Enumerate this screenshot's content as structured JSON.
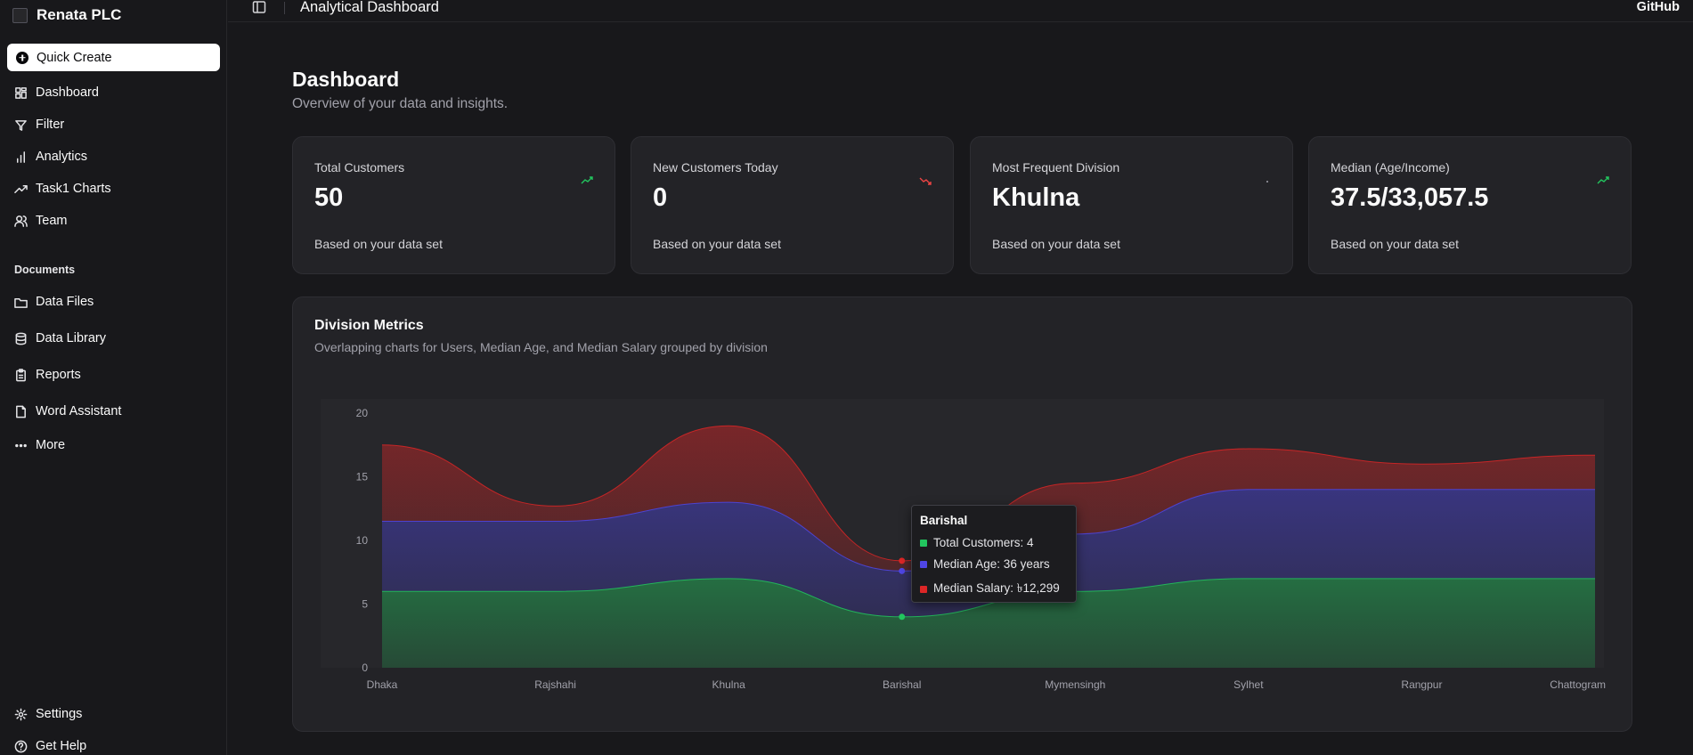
{
  "app": {
    "name": "Renata PLC"
  },
  "sidebar": {
    "quick_create": "Quick Create",
    "items": [
      {
        "label": "Dashboard",
        "icon": "dashboard-icon"
      },
      {
        "label": "Filter",
        "icon": "filter-icon"
      },
      {
        "label": "Analytics",
        "icon": "bar-chart-icon"
      },
      {
        "label": "Task1 Charts",
        "icon": "trending-icon"
      },
      {
        "label": "Team",
        "icon": "users-icon"
      }
    ],
    "documents_label": "Documents",
    "documents": [
      {
        "label": "Data Files",
        "icon": "folder-icon"
      },
      {
        "label": "Data Library",
        "icon": "database-icon"
      },
      {
        "label": "Reports",
        "icon": "clipboard-icon"
      },
      {
        "label": "Word Assistant",
        "icon": "file-icon"
      },
      {
        "label": "More",
        "icon": "more-icon"
      }
    ],
    "footer": [
      {
        "label": "Settings",
        "icon": "gear-icon"
      },
      {
        "label": "Get Help",
        "icon": "help-icon"
      }
    ]
  },
  "topbar": {
    "title": "Analytical Dashboard",
    "github": "GitHub"
  },
  "page": {
    "title": "Dashboard",
    "subtitle": "Overview of your data and insights."
  },
  "cards": [
    {
      "label": "Total Customers",
      "value": "50",
      "foot": "Based on your data set",
      "trend": "up",
      "trend_color": "#22c55e"
    },
    {
      "label": "New Customers Today",
      "value": "0",
      "foot": "Based on your data set",
      "trend": "down",
      "trend_color": "#ef4444"
    },
    {
      "label": "Most Frequent Division",
      "value": "Khulna",
      "foot": "Based on your data set",
      "trend": "flat",
      "trend_color": "#a1a1aa"
    },
    {
      "label": "Median (Age/Income)",
      "value": "37.5/33,057.5",
      "foot": "Based on your data set",
      "trend": "up",
      "trend_color": "#22c55e"
    }
  ],
  "chart_section": {
    "title": "Division Metrics",
    "subtitle": "Overlapping charts for Users, Median Age, and Median Salary grouped by division"
  },
  "chart_data": {
    "type": "area",
    "stacked": true,
    "categories": [
      "Dhaka",
      "Rajshahi",
      "Khulna",
      "Barishal",
      "Mymensingh",
      "Sylhet",
      "Rangpur",
      "Chattogram"
    ],
    "series": [
      {
        "name": "Total Customers",
        "color": "#22c55e",
        "values": [
          6,
          6,
          7,
          4,
          6,
          7,
          7,
          7
        ]
      },
      {
        "name": "Median Age",
        "color": "#4f46e5",
        "values": [
          5.5,
          5.5,
          6,
          3.6,
          4.5,
          7,
          7,
          7
        ]
      },
      {
        "name": "Median Salary",
        "color": "#dc2626",
        "values": [
          6,
          1.2,
          6,
          0.8,
          4,
          3.2,
          2,
          2.7
        ]
      }
    ],
    "yticks": [
      0,
      5,
      10,
      15,
      20
    ],
    "ylim": [
      0,
      20
    ],
    "grid": false,
    "active_index": 3
  },
  "tooltip": {
    "title": "Barishal",
    "rows": [
      {
        "label": "Total Customers: 4",
        "color": "#22c55e"
      },
      {
        "label": "Median Age: 36 years",
        "color": "#4f46e5"
      },
      {
        "label": "Median Salary: ৳12,299",
        "color": "#dc2626"
      }
    ]
  }
}
